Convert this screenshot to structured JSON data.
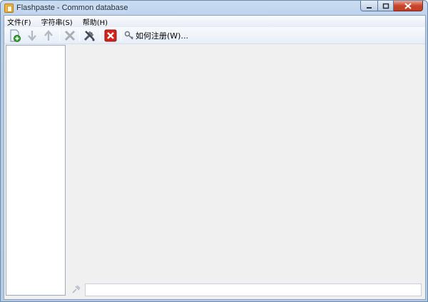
{
  "window": {
    "title": "Flashpaste - Common database",
    "controls": {
      "minimize": "minimize",
      "maximize": "maximize",
      "close": "close"
    }
  },
  "menubar": {
    "items": [
      "文件(F)",
      "字符串(S)",
      "帮助(H)"
    ]
  },
  "toolbar": {
    "buttons": [
      {
        "icon": "add-document-icon",
        "enabled": true
      },
      {
        "icon": "move-down-icon",
        "enabled": false
      },
      {
        "icon": "move-up-icon",
        "enabled": false
      },
      {
        "icon": "delete-icon",
        "enabled": false
      },
      {
        "icon": "tools-icon",
        "enabled": true
      },
      {
        "icon": "close-red-icon",
        "enabled": true
      }
    ],
    "register_label": "如何注册(W)..."
  },
  "bottom": {
    "input_value": "",
    "icon": "pin-icon"
  },
  "colors": {
    "titlebar": "#bed3ec",
    "client_bg": "#f0f0f0",
    "close_button": "#c9462c",
    "accent_green": "#3aa336"
  }
}
